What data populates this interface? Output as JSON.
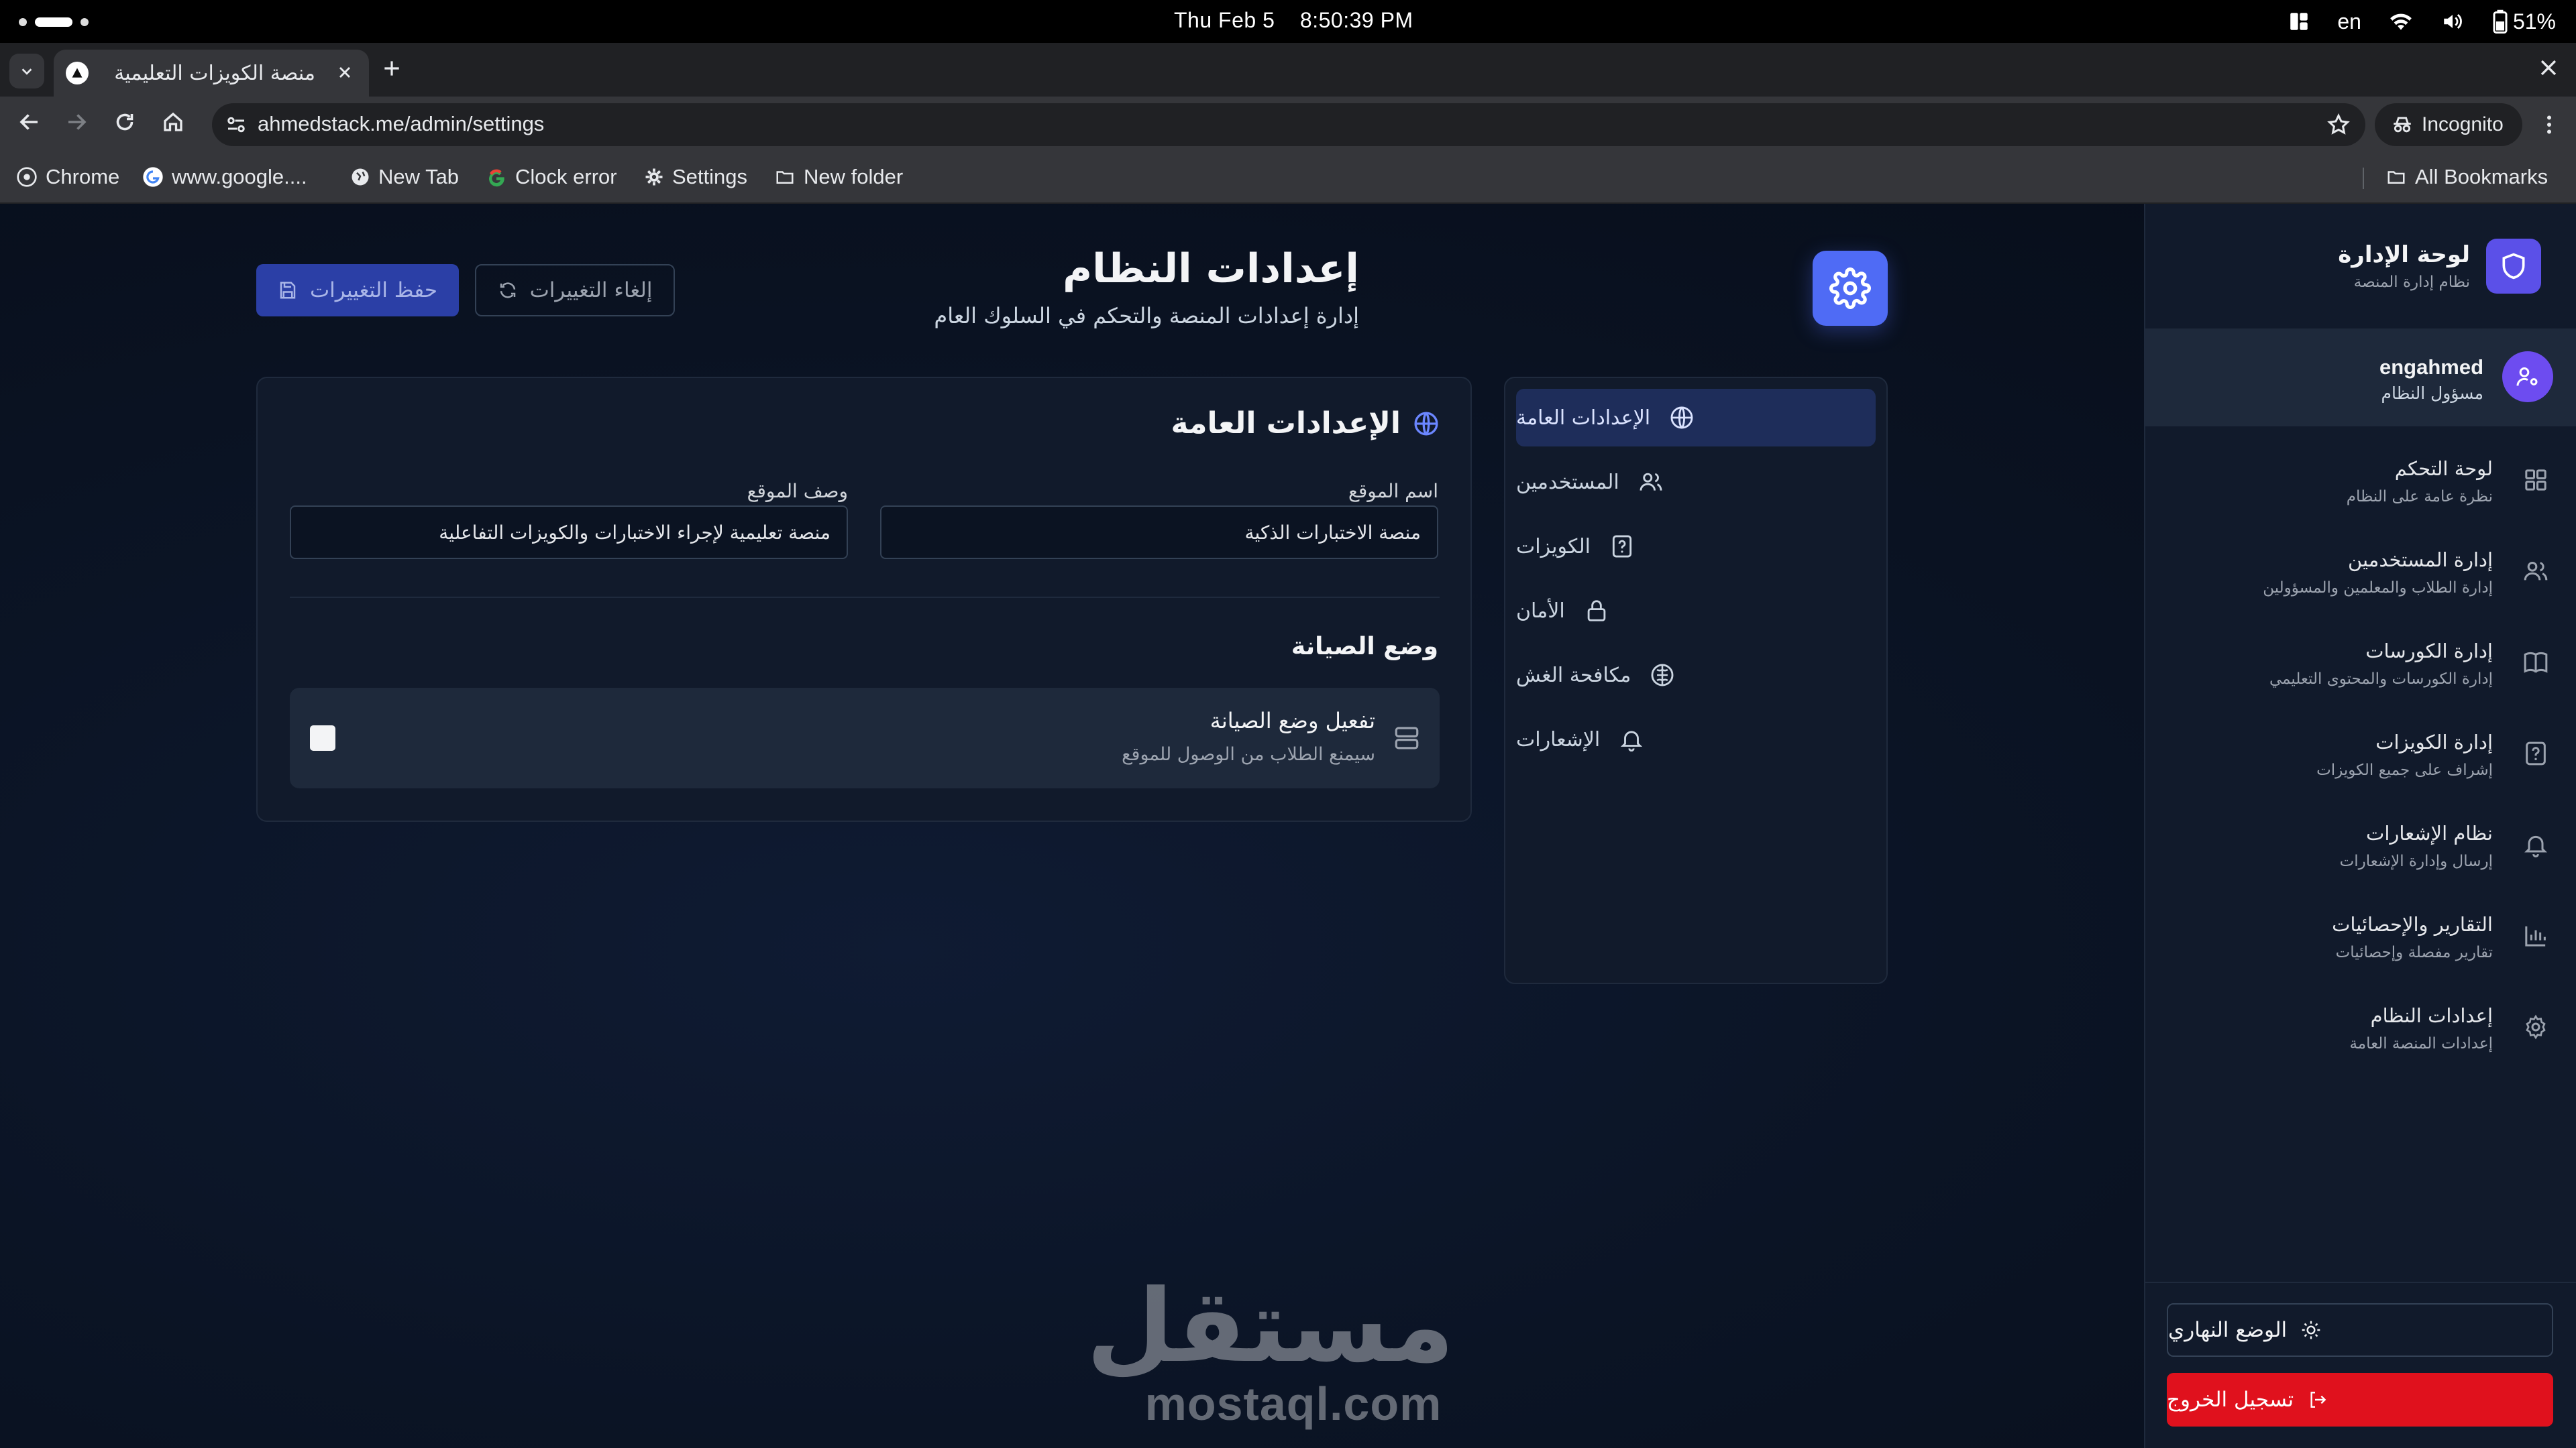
{
  "os_bar": {
    "datetime_date": "Thu Feb 5",
    "datetime_time": "8:50:39 PM",
    "language": "en",
    "battery": "51%"
  },
  "browser": {
    "tab_title": "منصة الكويزات التعليمية",
    "url": "ahmedstack.me/admin/settings",
    "incognito_label": "Incognito",
    "bookmarks": [
      "Chrome",
      "www.google....",
      "New Tab",
      "Clock error",
      "Settings",
      "New folder"
    ],
    "all_bookmarks_label": "All Bookmarks"
  },
  "header": {
    "title": "إعدادات النظام",
    "subtitle": "إدارة إعدادات المنصة والتحكم في السلوك العام",
    "save_label": "حفظ التغييرات",
    "cancel_label": "إلغاء التغييرات"
  },
  "settings_nav": [
    {
      "label": "الإعدادات العامة",
      "icon": "globe-icon",
      "active": true
    },
    {
      "label": "المستخدمين",
      "icon": "users-icon",
      "active": false
    },
    {
      "label": "الكويزات",
      "icon": "quiz-icon",
      "active": false
    },
    {
      "label": "الأمان",
      "icon": "lock-icon",
      "active": false
    },
    {
      "label": "مكافحة الغش",
      "icon": "brain-icon",
      "active": false
    },
    {
      "label": "الإشعارات",
      "icon": "bell-icon",
      "active": false
    }
  ],
  "general": {
    "title": "الإعدادات العامة",
    "site_name_label": "اسم الموقع",
    "site_name_value": "منصة الاختبارات الذكية",
    "site_desc_label": "وصف الموقع",
    "site_desc_value": "منصة تعليمية لإجراء الاختبارات والكويزات التفاعلية",
    "maintenance_title": "وضع الصيانة",
    "maintenance_toggle_label": "تفعيل وضع الصيانة",
    "maintenance_toggle_desc": "سيمنع الطلاب من الوصول للموقع",
    "maintenance_enabled": false
  },
  "sidebar": {
    "title": "لوحة الإدارة",
    "subtitle": "نظام إدارة المنصة",
    "user_name": "engahmed",
    "user_role": "مسؤول النظام",
    "items": [
      {
        "label": "لوحة التحكم",
        "desc": "نظرة عامة على النظام",
        "icon": "dashboard-icon"
      },
      {
        "label": "إدارة المستخدمين",
        "desc": "إدارة الطلاب والمعلمين والمسؤولين",
        "icon": "users-icon"
      },
      {
        "label": "إدارة الكورسات",
        "desc": "إدارة الكورسات والمحتوى التعليمي",
        "icon": "book-icon"
      },
      {
        "label": "إدارة الكويزات",
        "desc": "إشراف على جميع الكويزات",
        "icon": "quiz-icon"
      },
      {
        "label": "نظام الإشعارات",
        "desc": "إرسال وإدارة الإشعارات",
        "icon": "bell-icon"
      },
      {
        "label": "التقارير والإحصائيات",
        "desc": "تقارير مفصلة وإحصائيات",
        "icon": "chart-icon"
      },
      {
        "label": "إعدادات النظام",
        "desc": "إعدادات المنصة العامة",
        "icon": "gear-icon"
      }
    ],
    "theme_label": "الوضع النهاري",
    "logout_label": "تسجيل الخروج"
  },
  "watermark": {
    "arabic": "مستقل",
    "latin": "mostaql.com"
  },
  "colors": {
    "accent": "#4f6bf5",
    "logout": "#e0111d",
    "sidebar_shield": "#5b50e8"
  }
}
